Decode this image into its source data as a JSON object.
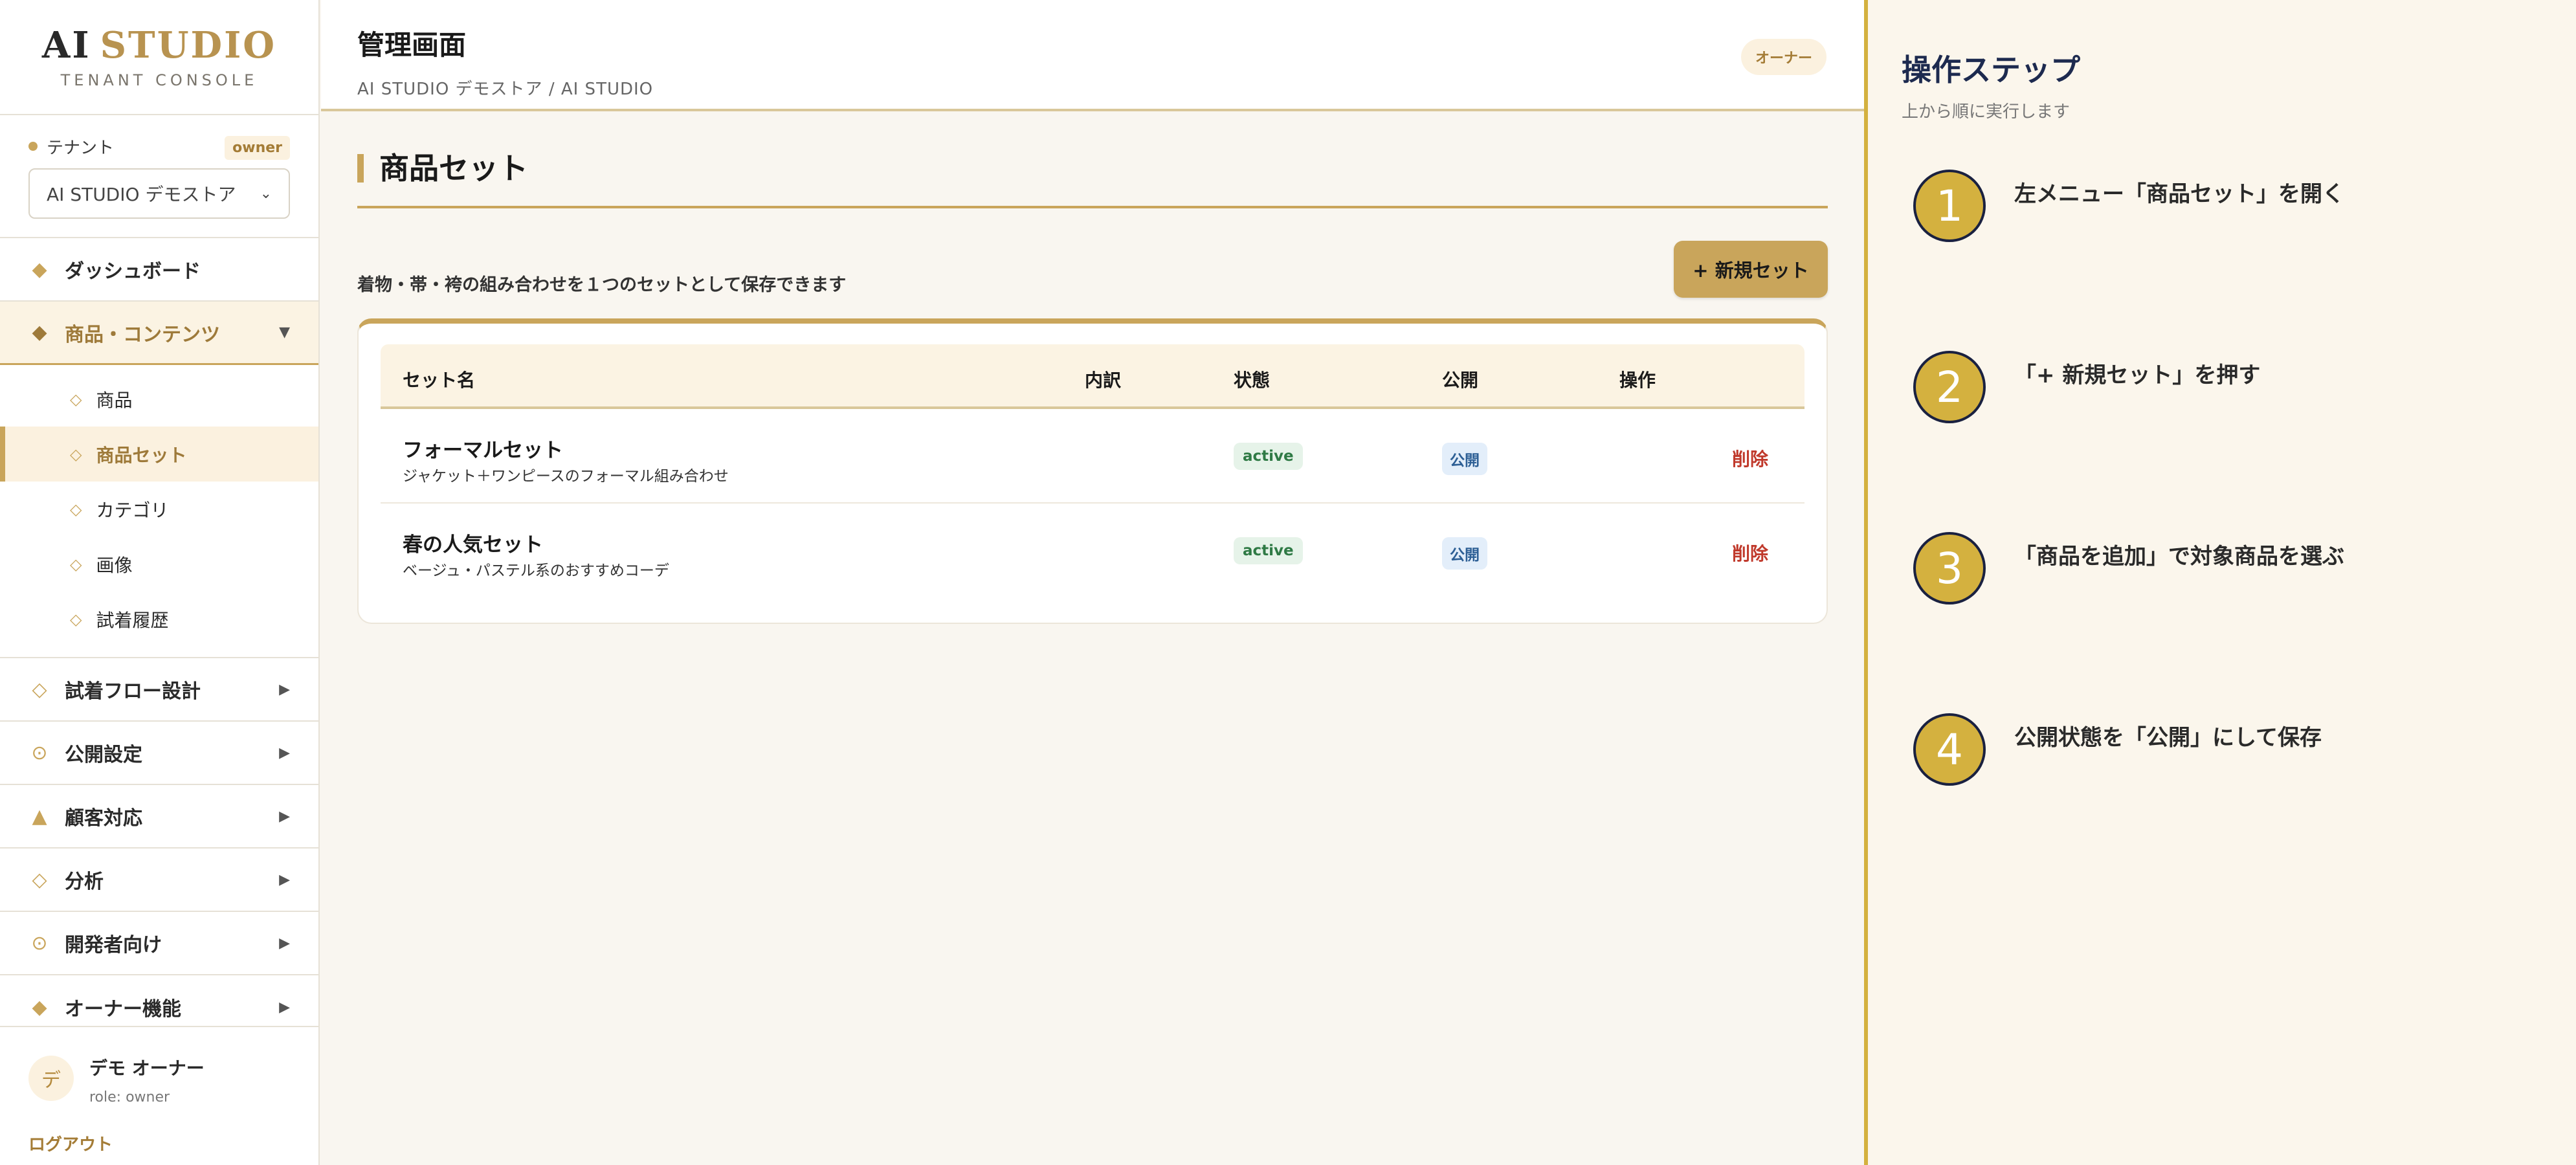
{
  "brand": {
    "ai": "AI",
    "studio": "STUDIO",
    "subtitle": "TENANT CONSOLE"
  },
  "tenant": {
    "label": "テナント",
    "role_badge": "owner",
    "selected": "AI STUDIO デモストア"
  },
  "nav": {
    "dashboard": "ダッシュボード",
    "products_contents": "商品・コンテンツ",
    "sub_items": [
      "商品",
      "商品セット",
      "カテゴリ",
      "画像",
      "試着履歴"
    ],
    "tryon_flow": "試着フロー設計",
    "publish_settings": "公開設定",
    "customer_support": "顧客対応",
    "analytics": "分析",
    "developers": "開発者向け",
    "owner_features": "オーナー機能"
  },
  "user": {
    "avatar": "デ",
    "name": "デモ オーナー",
    "role": "role: owner",
    "logout": "ログアウト"
  },
  "header": {
    "title": "管理画面",
    "breadcrumb": "AI STUDIO デモストア / AI STUDIO",
    "role_badge": "オーナー"
  },
  "section": {
    "title": "商品セット",
    "description": "着物・帯・袴の組み合わせを１つのセットとして保存できます",
    "new_button": "+ 新規セット"
  },
  "table": {
    "columns": [
      "セット名",
      "内訳",
      "状態",
      "公開",
      "操作"
    ],
    "rows": [
      {
        "name": "フォーマルセット",
        "desc": "ジャケット＋ワンピースのフォーマル組み合わせ",
        "status": "active",
        "public": "公開",
        "action": "削除"
      },
      {
        "name": "春の人気セット",
        "desc": "ベージュ・パステル系のおすすめコーデ",
        "status": "active",
        "public": "公開",
        "action": "削除"
      }
    ]
  },
  "steps": {
    "title": "操作ステップ",
    "subtitle": "上から順に実行します",
    "items": [
      {
        "num": "1",
        "text": "左メニュー「商品セット」を開く"
      },
      {
        "num": "2",
        "text": "「+ 新規セット」を押す"
      },
      {
        "num": "3",
        "text": "「商品を追加」で対象商品を選ぶ"
      },
      {
        "num": "4",
        "text": "公開状態を「公開」にして保存"
      }
    ]
  },
  "colors": {
    "accent": "#c9a55b",
    "step_gold": "#d4b13f",
    "navy": "#1a2140",
    "danger": "#c0392b"
  }
}
